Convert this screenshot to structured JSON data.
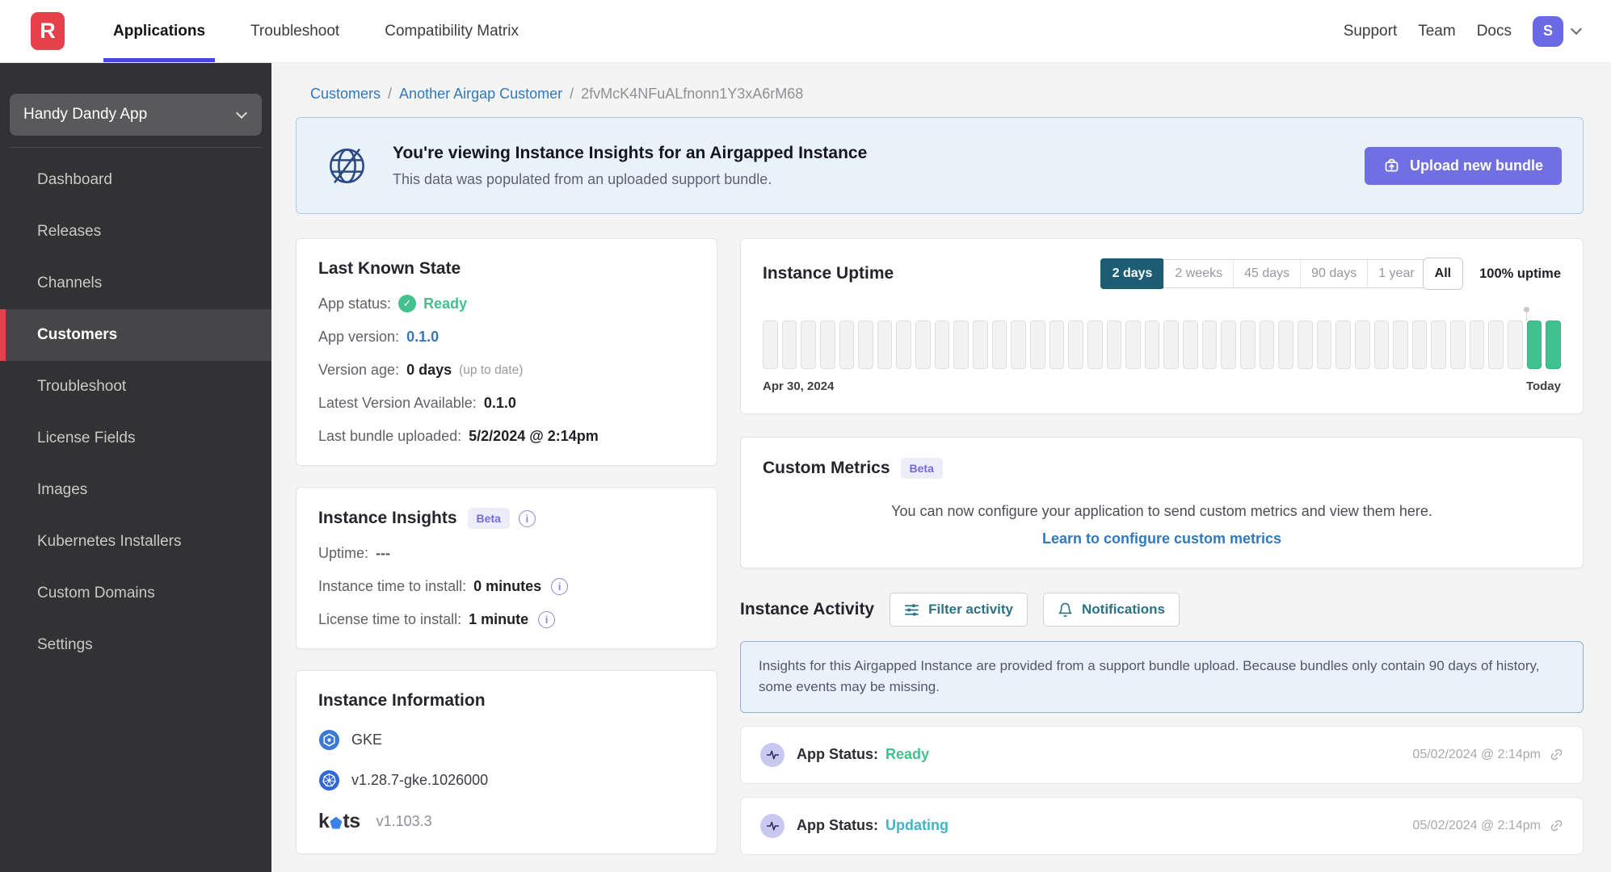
{
  "colors": {
    "brand-red": "#e8404a",
    "accent-blue": "#4845e4",
    "link-blue": "#3577b8",
    "button-purple": "#7170e2",
    "status-green": "#44c08e",
    "bar-green": "#3ec28f",
    "segment-active-teal": "#1c5d74",
    "button-teal-text": "#2a7286",
    "status-updating-teal": "#3fb5c6",
    "banner-bg": "#e9f1fb"
  },
  "icons": {
    "logo": "R monogram",
    "chevron-down": "v shape",
    "check-circle": "✓",
    "info": "i",
    "globe-slash": "globe with diagonal slash",
    "upload": "bundle box with up arrow",
    "filter": "sliders",
    "bell": "notification bell",
    "activity-pulse": "heartbeat line in circle",
    "link": "chain link",
    "gke": "blue circle hexagon",
    "kubernetes": "blue helm wheel"
  },
  "topnav": {
    "logo_letter": "R",
    "items": [
      {
        "label": "Applications",
        "active": true
      },
      {
        "label": "Troubleshoot"
      },
      {
        "label": "Compatibility Matrix"
      }
    ],
    "right_items": [
      "Support",
      "Team",
      "Docs"
    ],
    "avatar_initial": "S"
  },
  "sidebar": {
    "app_selector": "Handy Dandy App",
    "items": [
      {
        "label": "Dashboard"
      },
      {
        "label": "Releases"
      },
      {
        "label": "Channels"
      },
      {
        "label": "Customers",
        "active": true
      },
      {
        "label": "Troubleshoot"
      },
      {
        "label": "License Fields"
      },
      {
        "label": "Images"
      },
      {
        "label": "Kubernetes Installers"
      },
      {
        "label": "Custom Domains"
      },
      {
        "label": "Settings"
      }
    ]
  },
  "breadcrumb": {
    "items": [
      {
        "label": "Customers",
        "link": true,
        "sep": ""
      },
      {
        "label": "Another Airgap Customer",
        "link": true,
        "sep": "/"
      },
      {
        "label": "2fvMcK4NFuALfnonn1Y3xA6rM68",
        "link": false,
        "sep": "/"
      }
    ]
  },
  "banner": {
    "title": "You're viewing Instance Insights for an Airgapped Instance",
    "subtitle": "This data was populated from an uploaded support bundle.",
    "button": "Upload new bundle"
  },
  "last_known_state": {
    "title": "Last Known State",
    "rows": [
      {
        "label": "App status:",
        "value": "Ready",
        "vclass": "v-green",
        "check": true
      },
      {
        "label": "App version:",
        "value": "0.1.0",
        "vclass": "v-link"
      },
      {
        "label": "Version age:",
        "value": "0 days",
        "vclass": "v-bold",
        "note": "(up to date)"
      },
      {
        "label": "Latest Version Available:",
        "value": "0.1.0",
        "vclass": "v-bold"
      },
      {
        "label": "Last bundle uploaded:",
        "value": "5/2/2024 @ 2:14pm",
        "vclass": "v-bold"
      }
    ]
  },
  "instance_insights": {
    "title": "Instance Insights",
    "beta": "Beta",
    "rows": [
      {
        "label": "Uptime:",
        "value": "---",
        "vclass": "v-dash"
      },
      {
        "label": "Instance time to install:",
        "value": "0 minutes",
        "vclass": "v-bold",
        "info": true
      },
      {
        "label": "License time to install:",
        "value": "1 minute",
        "vclass": "v-bold",
        "info": true
      }
    ]
  },
  "instance_information": {
    "title": "Instance Information",
    "rows": [
      {
        "icon": "gke-icon",
        "value": "GKE"
      },
      {
        "icon": "kubernetes-icon",
        "value": "v1.28.7-gke.1026000"
      },
      {
        "icon": "kots-logo",
        "value": "v1.103.3"
      }
    ],
    "kots_wordmark_pre": "k",
    "kots_wordmark_post": "ts"
  },
  "uptime": {
    "title": "Instance Uptime",
    "ranges": [
      {
        "label": "2 days",
        "active": true
      },
      {
        "label": "2 weeks"
      },
      {
        "label": "45 days"
      },
      {
        "label": "90 days"
      },
      {
        "label": "1 year"
      },
      {
        "label": "All",
        "emphasis": true
      }
    ],
    "summary": "100% uptime",
    "start_label": "Apr 30, 2024",
    "end_label": "Today"
  },
  "chart_data": {
    "type": "bar",
    "title": "Instance Uptime",
    "description": "Daily uptime status strip; gray = no data, green = up",
    "selected_range": "2 days",
    "uptime_percent_label": "100% uptime",
    "x_start_label": "Apr 30, 2024",
    "x_end_label": "Today",
    "marker_index": 40,
    "states": [
      "empty",
      "empty",
      "empty",
      "empty",
      "empty",
      "empty",
      "empty",
      "empty",
      "empty",
      "empty",
      "empty",
      "empty",
      "empty",
      "empty",
      "empty",
      "empty",
      "empty",
      "empty",
      "empty",
      "empty",
      "empty",
      "empty",
      "empty",
      "empty",
      "empty",
      "empty",
      "empty",
      "empty",
      "empty",
      "empty",
      "empty",
      "empty",
      "empty",
      "empty",
      "empty",
      "empty",
      "empty",
      "empty",
      "empty",
      "empty",
      "up",
      "up"
    ]
  },
  "custom_metrics": {
    "title": "Custom Metrics",
    "beta": "Beta",
    "body": "You can now configure your application to send custom metrics and view them here.",
    "link": "Learn to configure custom metrics"
  },
  "activity": {
    "title": "Instance Activity",
    "filter_button": "Filter activity",
    "notifications_button": "Notifications",
    "note": "Insights for this Airgapped Instance are provided from a support bundle upload. Because bundles only contain 90 days of history, some events may be missing.",
    "rows": [
      {
        "label": "App Status:",
        "value": "Ready",
        "vclass": "v-green",
        "timestamp": "05/02/2024 @ 2:14pm"
      },
      {
        "label": "App Status:",
        "value": "Updating",
        "vclass": "v-teal",
        "timestamp": "05/02/2024 @ 2:14pm"
      }
    ]
  }
}
